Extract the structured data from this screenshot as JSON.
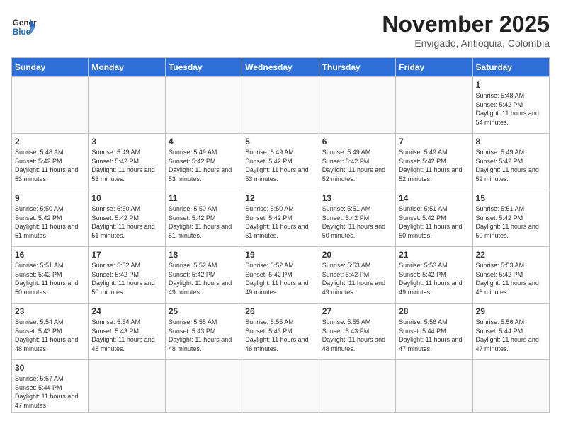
{
  "header": {
    "logo_line1": "General",
    "logo_line2": "Blue",
    "month_title": "November 2025",
    "location": "Envigado, Antioquia, Colombia"
  },
  "days_of_week": [
    "Sunday",
    "Monday",
    "Tuesday",
    "Wednesday",
    "Thursday",
    "Friday",
    "Saturday"
  ],
  "weeks": [
    [
      {
        "day": "",
        "content": ""
      },
      {
        "day": "",
        "content": ""
      },
      {
        "day": "",
        "content": ""
      },
      {
        "day": "",
        "content": ""
      },
      {
        "day": "",
        "content": ""
      },
      {
        "day": "",
        "content": ""
      },
      {
        "day": "1",
        "content": "Sunrise: 5:48 AM\nSunset: 5:42 PM\nDaylight: 11 hours\nand 54 minutes."
      }
    ],
    [
      {
        "day": "2",
        "content": "Sunrise: 5:48 AM\nSunset: 5:42 PM\nDaylight: 11 hours\nand 53 minutes."
      },
      {
        "day": "3",
        "content": "Sunrise: 5:49 AM\nSunset: 5:42 PM\nDaylight: 11 hours\nand 53 minutes."
      },
      {
        "day": "4",
        "content": "Sunrise: 5:49 AM\nSunset: 5:42 PM\nDaylight: 11 hours\nand 53 minutes."
      },
      {
        "day": "5",
        "content": "Sunrise: 5:49 AM\nSunset: 5:42 PM\nDaylight: 11 hours\nand 53 minutes."
      },
      {
        "day": "6",
        "content": "Sunrise: 5:49 AM\nSunset: 5:42 PM\nDaylight: 11 hours\nand 52 minutes."
      },
      {
        "day": "7",
        "content": "Sunrise: 5:49 AM\nSunset: 5:42 PM\nDaylight: 11 hours\nand 52 minutes."
      },
      {
        "day": "8",
        "content": "Sunrise: 5:49 AM\nSunset: 5:42 PM\nDaylight: 11 hours\nand 52 minutes."
      }
    ],
    [
      {
        "day": "9",
        "content": "Sunrise: 5:50 AM\nSunset: 5:42 PM\nDaylight: 11 hours\nand 51 minutes."
      },
      {
        "day": "10",
        "content": "Sunrise: 5:50 AM\nSunset: 5:42 PM\nDaylight: 11 hours\nand 51 minutes."
      },
      {
        "day": "11",
        "content": "Sunrise: 5:50 AM\nSunset: 5:42 PM\nDaylight: 11 hours\nand 51 minutes."
      },
      {
        "day": "12",
        "content": "Sunrise: 5:50 AM\nSunset: 5:42 PM\nDaylight: 11 hours\nand 51 minutes."
      },
      {
        "day": "13",
        "content": "Sunrise: 5:51 AM\nSunset: 5:42 PM\nDaylight: 11 hours\nand 50 minutes."
      },
      {
        "day": "14",
        "content": "Sunrise: 5:51 AM\nSunset: 5:42 PM\nDaylight: 11 hours\nand 50 minutes."
      },
      {
        "day": "15",
        "content": "Sunrise: 5:51 AM\nSunset: 5:42 PM\nDaylight: 11 hours\nand 50 minutes."
      }
    ],
    [
      {
        "day": "16",
        "content": "Sunrise: 5:51 AM\nSunset: 5:42 PM\nDaylight: 11 hours\nand 50 minutes."
      },
      {
        "day": "17",
        "content": "Sunrise: 5:52 AM\nSunset: 5:42 PM\nDaylight: 11 hours\nand 50 minutes."
      },
      {
        "day": "18",
        "content": "Sunrise: 5:52 AM\nSunset: 5:42 PM\nDaylight: 11 hours\nand 49 minutes."
      },
      {
        "day": "19",
        "content": "Sunrise: 5:52 AM\nSunset: 5:42 PM\nDaylight: 11 hours\nand 49 minutes."
      },
      {
        "day": "20",
        "content": "Sunrise: 5:53 AM\nSunset: 5:42 PM\nDaylight: 11 hours\nand 49 minutes."
      },
      {
        "day": "21",
        "content": "Sunrise: 5:53 AM\nSunset: 5:42 PM\nDaylight: 11 hours\nand 49 minutes."
      },
      {
        "day": "22",
        "content": "Sunrise: 5:53 AM\nSunset: 5:42 PM\nDaylight: 11 hours\nand 48 minutes."
      }
    ],
    [
      {
        "day": "23",
        "content": "Sunrise: 5:54 AM\nSunset: 5:43 PM\nDaylight: 11 hours\nand 48 minutes."
      },
      {
        "day": "24",
        "content": "Sunrise: 5:54 AM\nSunset: 5:43 PM\nDaylight: 11 hours\nand 48 minutes."
      },
      {
        "day": "25",
        "content": "Sunrise: 5:55 AM\nSunset: 5:43 PM\nDaylight: 11 hours\nand 48 minutes."
      },
      {
        "day": "26",
        "content": "Sunrise: 5:55 AM\nSunset: 5:43 PM\nDaylight: 11 hours\nand 48 minutes."
      },
      {
        "day": "27",
        "content": "Sunrise: 5:55 AM\nSunset: 5:43 PM\nDaylight: 11 hours\nand 48 minutes."
      },
      {
        "day": "28",
        "content": "Sunrise: 5:56 AM\nSunset: 5:44 PM\nDaylight: 11 hours\nand 47 minutes."
      },
      {
        "day": "29",
        "content": "Sunrise: 5:56 AM\nSunset: 5:44 PM\nDaylight: 11 hours\nand 47 minutes."
      }
    ],
    [
      {
        "day": "30",
        "content": "Sunrise: 5:57 AM\nSunset: 5:44 PM\nDaylight: 11 hours\nand 47 minutes."
      },
      {
        "day": "",
        "content": ""
      },
      {
        "day": "",
        "content": ""
      },
      {
        "day": "",
        "content": ""
      },
      {
        "day": "",
        "content": ""
      },
      {
        "day": "",
        "content": ""
      },
      {
        "day": "",
        "content": ""
      }
    ]
  ]
}
